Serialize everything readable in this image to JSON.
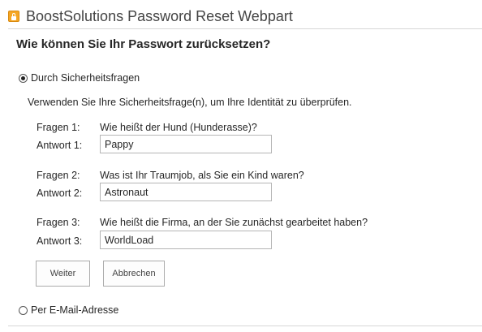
{
  "webpart": {
    "title": "BoostSolutions Password Reset Webpart",
    "icon": "password-reset-lock-icon",
    "accent_color": "#f5a623"
  },
  "heading": "Wie können Sie Ihr Passwort zurücksetzen?",
  "options": {
    "security_questions": {
      "label": "Durch Sicherheitsfragen",
      "selected": true
    },
    "email": {
      "label": "Per E-Mail-Adresse",
      "selected": false
    }
  },
  "instruction": "Verwenden Sie Ihre Sicherheitsfrage(n), um Ihre Identität zu überprüfen.",
  "questions": [
    {
      "question_label": "Fragen 1:",
      "question": "Wie heißt der Hund (Hunderasse)?",
      "answer_label": "Antwort 1:",
      "answer": "Pappy"
    },
    {
      "question_label": "Fragen 2:",
      "question": "Was ist Ihr Traumjob, als Sie ein Kind waren?",
      "answer_label": "Antwort 2:",
      "answer": "Astronaut"
    },
    {
      "question_label": "Fragen 3:",
      "question": "Wie heißt die Firma, an der Sie zunächst gearbeitet haben?",
      "answer_label": "Antwort 3:",
      "answer": "WorldLoad"
    }
  ],
  "buttons": {
    "next_label": "Weiter",
    "cancel_label": "Abbrechen"
  }
}
